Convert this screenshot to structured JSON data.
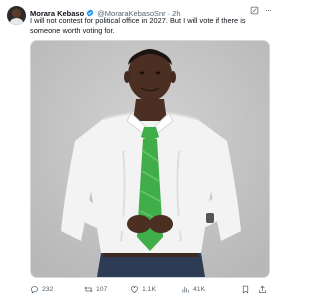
{
  "tweet": {
    "author_name": "Morara Kebaso",
    "handle": "@MoraraKebasoSnr",
    "time": "2h",
    "text": "I will not contest for political office in 2027. But I will vote if there is someone worth voting for.",
    "stats": {
      "replies": "232",
      "reposts": "107",
      "likes": "1.1K",
      "views": "41K"
    }
  },
  "colors": {
    "verified": "#1d9bf0",
    "muted_text": "#536471",
    "tie": "#3fae49",
    "shirt": "#f4f4f4",
    "backdrop": "#c9c9c9"
  },
  "icons": [
    "verified-badge-icon",
    "grok-icon",
    "more-icon",
    "reply-icon",
    "repost-icon",
    "like-icon",
    "views-icon",
    "bookmark-icon",
    "share-icon"
  ]
}
